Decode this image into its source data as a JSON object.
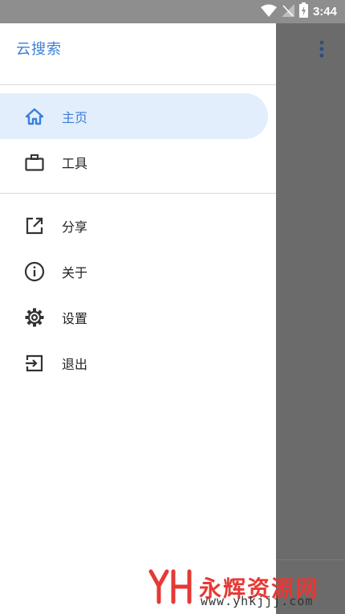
{
  "status_bar": {
    "time": "3:44"
  },
  "drawer": {
    "title": "云搜索",
    "primary_items": [
      {
        "label": "主页",
        "icon": "home-icon",
        "active": true
      },
      {
        "label": "工具",
        "icon": "briefcase-icon",
        "active": false
      }
    ],
    "secondary_items": [
      {
        "label": "分享",
        "icon": "share-icon"
      },
      {
        "label": "关于",
        "icon": "info-icon"
      },
      {
        "label": "设置",
        "icon": "gear-icon"
      },
      {
        "label": "退出",
        "icon": "exit-icon"
      }
    ]
  },
  "watermark": {
    "logo_text": "YH",
    "title": "永辉资源网",
    "url": "www.yhkjjj.com"
  },
  "colors": {
    "accent": "#3b7fd9",
    "active_bg": "#e3eefc",
    "watermark": "#e53935",
    "scrim": "#6b6b6b"
  }
}
